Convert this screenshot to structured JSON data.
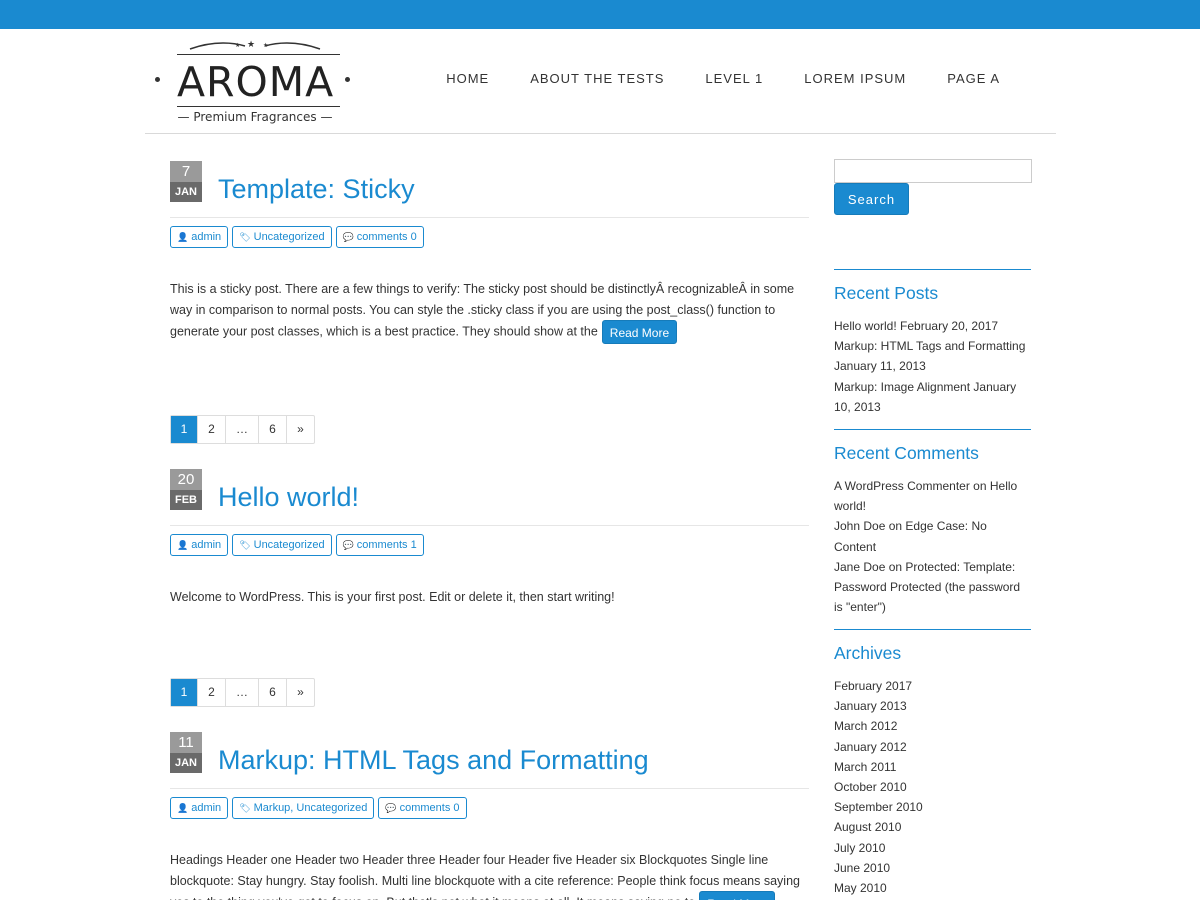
{
  "brand": {
    "name": "AROMA",
    "tagline": "Premium Fragrances"
  },
  "nav": [
    "HOME",
    "ABOUT THE TESTS",
    "LEVEL 1",
    "LOREM IPSUM",
    "PAGE A"
  ],
  "posts": [
    {
      "day": "7",
      "month": "JAN",
      "title": "Template: Sticky",
      "author": "admin",
      "categories": "Uncategorized",
      "comments": "comments 0",
      "excerpt": "This is a sticky post. There are a few things to verify: The sticky post should be distinctlyÂ recognizableÂ in some way in comparison to normal posts. You can style the .sticky class if you are using the post_class() function to generate your post classes, which is a best practice. They should show at the",
      "read_more": "Read More"
    },
    {
      "day": "20",
      "month": "FEB",
      "title": "Hello world!",
      "author": "admin",
      "categories": "Uncategorized",
      "comments": "comments 1",
      "excerpt": "Welcome to WordPress. This is your first post. Edit or delete it, then start writing!",
      "read_more": ""
    },
    {
      "day": "11",
      "month": "JAN",
      "title": "Markup: HTML Tags and Formatting",
      "author": "admin",
      "categories": "Markup, Uncategorized",
      "comments": "comments 0",
      "excerpt": "Headings Header one Header two Header three Header four Header five Header six Blockquotes Single line blockquote: Stay hungry. Stay foolish. Multi line blockquote with a cite reference: People think focus means saying yes to the thing you've got to focus on. But that's not what it means at all. It means saying no to",
      "read_more": "Read More"
    }
  ],
  "pagination": [
    "1",
    "2",
    "…",
    "6",
    "»"
  ],
  "sidebar": {
    "search_button": "Search",
    "search_placeholder": "",
    "recent_posts_title": "Recent Posts",
    "recent_posts": [
      {
        "title": "Hello world!",
        "date": "February 20, 2017"
      },
      {
        "title": "Markup: HTML Tags and Formatting",
        "date": "January 11, 2013"
      },
      {
        "title": "Markup: Image Alignment",
        "date": "January 10, 2013"
      }
    ],
    "recent_comments_title": "Recent Comments",
    "recent_comments": [
      {
        "author": "A WordPress Commenter",
        "on": "on",
        "post": "Hello world!"
      },
      {
        "author": "John Doe",
        "on": "on",
        "post": "Edge Case: No Content"
      },
      {
        "author": "Jane Doe",
        "on": "on",
        "post": "Protected: Template: Password Protected (the password is \"enter\")"
      }
    ],
    "archives_title": "Archives",
    "archives": [
      "February 2017",
      "January 2013",
      "March 2012",
      "January 2012",
      "March 2011",
      "October 2010",
      "September 2010",
      "August 2010",
      "July 2010",
      "June 2010",
      "May 2010"
    ]
  },
  "colors": {
    "accent": "#1a8ad0",
    "date_day_bg": "#9a9a9a",
    "date_month_bg": "#6a6a6a"
  }
}
